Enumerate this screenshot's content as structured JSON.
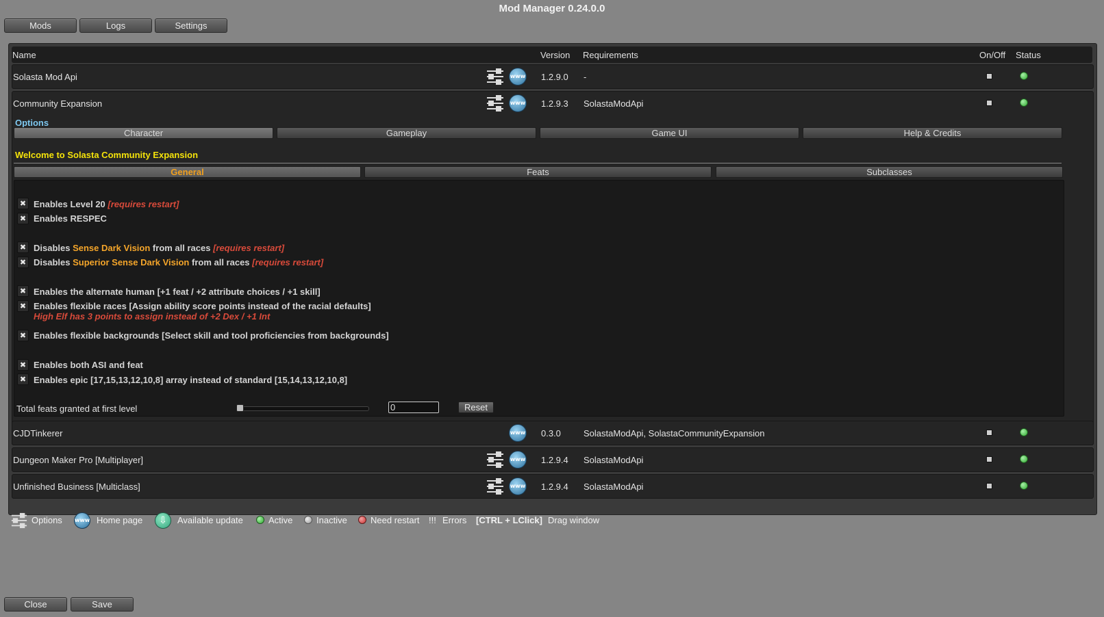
{
  "window": {
    "title": "Mod Manager 0.24.0.0"
  },
  "top_tabs": [
    "Mods",
    "Logs",
    "Settings"
  ],
  "table": {
    "headers": {
      "name": "Name",
      "version": "Version",
      "requirements": "Requirements",
      "onoff": "On/Off",
      "status": "Status"
    },
    "mods": [
      {
        "name": "Solasta Mod Api",
        "version": "1.2.9.0",
        "requirements": "-",
        "has_options": true,
        "enabled": true,
        "status": "active"
      },
      {
        "name": "Community Expansion",
        "version": "1.2.9.3",
        "requirements": "SolastaModApi",
        "has_options": true,
        "enabled": true,
        "status": "active"
      },
      {
        "name": "CJDTinkerer",
        "version": "0.3.0",
        "requirements": "SolastaModApi, SolastaCommunityExpansion",
        "has_options": false,
        "enabled": true,
        "status": "active"
      },
      {
        "name": "Dungeon Maker Pro [Multiplayer]",
        "version": "1.2.9.4",
        "requirements": "SolastaModApi",
        "has_options": true,
        "enabled": true,
        "status": "active"
      },
      {
        "name": "Unfinished Business [Multiclass]",
        "version": "1.2.9.4",
        "requirements": "SolastaModApi",
        "has_options": true,
        "enabled": true,
        "status": "active"
      }
    ]
  },
  "expanded": {
    "options_label": "Options",
    "category_tabs": [
      "Character",
      "Gameplay",
      "Game UI",
      "Help & Credits"
    ],
    "selected_category": "Character",
    "welcome": "Welcome to Solasta Community Expansion",
    "sub_tabs": [
      "General",
      "Feats",
      "Subclasses"
    ],
    "selected_sub_tab": "General",
    "settings": {
      "level20": {
        "text": "Enables Level 20",
        "suffix": "[requires restart]"
      },
      "respec": {
        "text": "Enables RESPEC"
      },
      "sense_dark": {
        "pre": "Disables ",
        "hl": "Sense Dark Vision",
        "post": " from all races ",
        "suffix": "[requires restart]"
      },
      "superior_dark": {
        "pre": "Disables ",
        "hl": "Superior Sense Dark Vision",
        "post": " from all races ",
        "suffix": "[requires restart]"
      },
      "alt_human": {
        "text": "Enables the alternate human [+1 feat / +2 attribute choices / +1 skill]"
      },
      "flex_races": {
        "text": "Enables flexible races [Assign ability score points instead of the racial defaults]",
        "note": "High Elf has 3 points to assign instead of +2 Dex / +1 Int"
      },
      "flex_backgrounds": {
        "text": "Enables flexible backgrounds [Select skill and tool proficiencies from backgrounds]"
      },
      "asi_feat": {
        "text": "Enables both ASI and feat"
      },
      "epic_array": {
        "text": "Enables epic [17,15,13,12,10,8] array instead of standard [15,14,13,12,10,8]"
      }
    },
    "feats_slider": {
      "label": "Total feats granted at first level",
      "value": "0",
      "reset_label": "Reset",
      "fraction": 0
    }
  },
  "legend": {
    "options": "Options",
    "home_page": "Home page",
    "update": "Available update",
    "active": "Active",
    "inactive": "Inactive",
    "need_restart": "Need restart",
    "errors_mark": "!!!",
    "errors": "Errors",
    "shortcut": "[CTRL + LClick]",
    "drag": "Drag window"
  },
  "footer": {
    "close": "Close",
    "save": "Save"
  },
  "colors": {
    "active": "#2fa82f",
    "inactive": "#9a9a9a",
    "restart": "#c83030",
    "highlight": "#f4a52a",
    "req": "#d84a3a",
    "welcome": "#f5e30a",
    "options_label": "#7ec8f0"
  },
  "icons": {
    "options": "sliders-icon",
    "home": "www-globe-icon",
    "update": "download-icon"
  }
}
